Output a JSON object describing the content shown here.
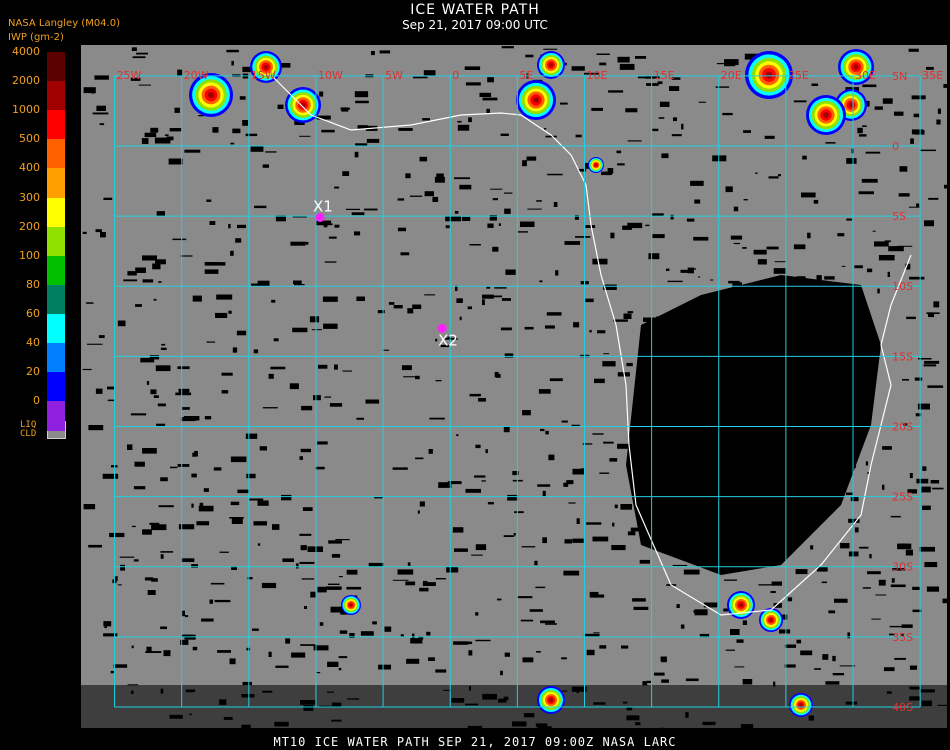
{
  "header": {
    "title": "ICE WATER PATH",
    "datetime": "Sep 21, 2017 09:00 UTC",
    "source": "NASA Langley (M04.0)",
    "unit": "IWP (gm-2)"
  },
  "legend": {
    "ticks": [
      "4000",
      "2000",
      "1000",
      "500",
      "400",
      "300",
      "200",
      "100",
      "80",
      "60",
      "40",
      "20",
      "0"
    ],
    "colors": [
      "#5a0000",
      "#a00000",
      "#ff0000",
      "#ff6000",
      "#ffa000",
      "#ffff00",
      "#90e000",
      "#00c000",
      "#008060",
      "#00ffff",
      "#0080ff",
      "#0000ff",
      "#9020e0"
    ],
    "liquid_label_1": "LIQ",
    "liquid_label_2": "CLD",
    "liquid_color": "#8a8a8a"
  },
  "map": {
    "background": "#8a8a8a",
    "grid_color": "#20d0e0",
    "label_color": "#e03030",
    "lon_labels": [
      "25W",
      "20W",
      "15W",
      "10W",
      "5W",
      "0",
      "5E",
      "10E",
      "15E",
      "20E",
      "25E",
      "30E",
      "35E"
    ],
    "lat_labels": [
      "5N",
      "0",
      "5S",
      "10S",
      "15S",
      "20S",
      "25S",
      "30S",
      "35S",
      "40S"
    ],
    "markers": [
      {
        "label": "X1",
        "lon": -9.7,
        "lat": -5.1
      },
      {
        "label": "X2",
        "lon": -0.6,
        "lat": -13.0
      }
    ]
  },
  "footer": "MT10   ICE WATER PATH   SEP 21, 2017 09:00Z   NASA LARC"
}
